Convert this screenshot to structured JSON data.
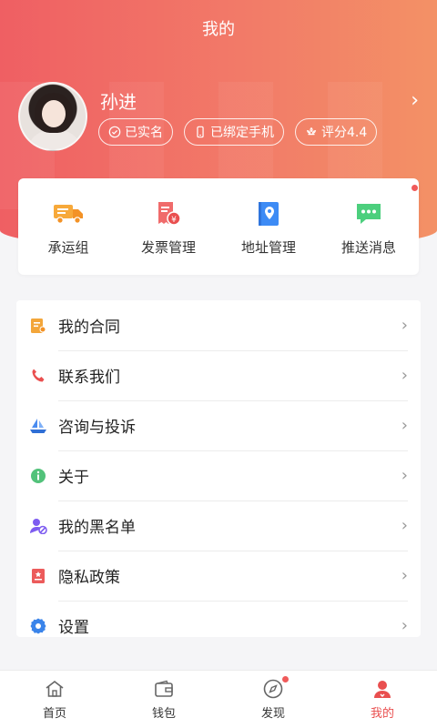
{
  "header": {
    "title": "我的"
  },
  "user": {
    "name": "孙进",
    "badges": [
      {
        "icon": "check-circle-icon",
        "label": "已实名"
      },
      {
        "icon": "phone-icon",
        "label": "已绑定手机"
      },
      {
        "icon": "flower-icon",
        "label": "评分4.4"
      }
    ]
  },
  "quick_actions": [
    {
      "icon": "truck-icon",
      "label": "承运组"
    },
    {
      "icon": "invoice-icon",
      "label": "发票管理"
    },
    {
      "icon": "location-book-icon",
      "label": "地址管理"
    },
    {
      "icon": "message-icon",
      "label": "推送消息",
      "has_dot": true
    }
  ],
  "menu": [
    {
      "icon": "contract-icon",
      "label": "我的合同"
    },
    {
      "icon": "phone-call-icon",
      "label": "联系我们"
    },
    {
      "icon": "boat-icon",
      "label": "咨询与投诉"
    },
    {
      "icon": "info-icon",
      "label": "关于"
    },
    {
      "icon": "user-block-icon",
      "label": "我的黑名单"
    },
    {
      "icon": "privacy-icon",
      "label": "隐私政策"
    },
    {
      "icon": "gear-icon",
      "label": "设置"
    }
  ],
  "tabbar": [
    {
      "icon": "home-icon",
      "label": "首页"
    },
    {
      "icon": "wallet-icon",
      "label": "钱包"
    },
    {
      "icon": "compass-icon",
      "label": "发现",
      "has_dot": true
    },
    {
      "icon": "user-icon",
      "label": "我的",
      "active": true
    }
  ],
  "colors": {
    "accent": "#e94f4f",
    "header_start": "#ef5f63",
    "header_end": "#f39166"
  }
}
